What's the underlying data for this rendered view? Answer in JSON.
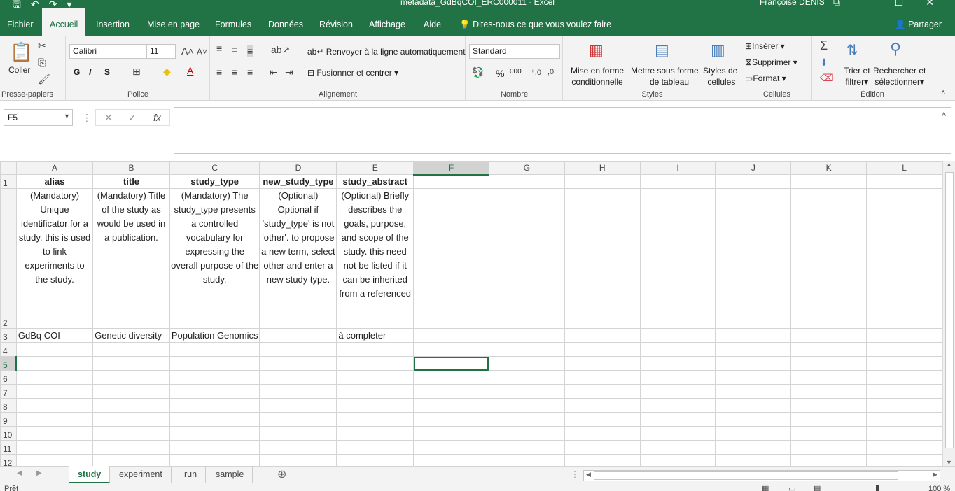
{
  "window": {
    "title": "metadata_GdBqCOI_ERC000011 - Excel",
    "user": "Françoise DENIS"
  },
  "menu": {
    "tabs": [
      "Fichier",
      "Accueil",
      "Insertion",
      "Mise en page",
      "Formules",
      "Données",
      "Révision",
      "Affichage",
      "Aide"
    ],
    "active": "Accueil",
    "tellme": "Dites-nous ce que vous voulez faire",
    "share": "Partager"
  },
  "ribbon": {
    "clipboard": {
      "paste": "Coller",
      "label": "Presse-papiers"
    },
    "font": {
      "name": "Calibri",
      "size": "11",
      "label": "Police",
      "bold": "G",
      "italic": "I",
      "underline": "S"
    },
    "alignment": {
      "wrap": "Renvoyer à la ligne automatiquement",
      "merge": "Fusionner et centrer",
      "label": "Alignement"
    },
    "number": {
      "format": "Standard",
      "label": "Nombre",
      "percent": "%",
      "thousands": "000"
    },
    "styles": {
      "conditional1": "Mise en forme",
      "conditional2": "conditionnelle",
      "table1": "Mettre sous forme",
      "table2": "de tableau",
      "cell1": "Styles de",
      "cell2": "cellules",
      "label": "Styles"
    },
    "cells": {
      "insert": "Insérer",
      "delete": "Supprimer",
      "format": "Format",
      "label": "Cellules"
    },
    "editing": {
      "sort1": "Trier et",
      "sort2": "filtrer",
      "find1": "Rechercher et",
      "find2": "sélectionner",
      "label": "Édition"
    }
  },
  "formula": {
    "namebox": "F5",
    "fx": "fx",
    "content": ""
  },
  "grid": {
    "columns": [
      "A",
      "B",
      "C",
      "D",
      "E",
      "F",
      "G",
      "H",
      "I",
      "J",
      "K",
      "L"
    ],
    "selected_column": "F",
    "selected_row": "5",
    "rows": [
      "1",
      "2",
      "3",
      "4",
      "5",
      "6",
      "7",
      "8",
      "9",
      "10",
      "11",
      "12"
    ],
    "headers": [
      "alias",
      "title",
      "study_type",
      "new_study_type",
      "study_abstract"
    ],
    "descriptions": [
      "(Mandatory) Unique identificator for a study. this is used to link experiments to the study.",
      "(Mandatory) Title of the study as would be used in a publication.",
      "(Mandatory) The study_type presents a controlled vocabulary for expressing the overall purpose of the study.",
      "(Optional) Optional if 'study_type' is not 'other'. to propose a new term, select other and enter a new study type.",
      "(Optional) Briefly describes the goals, purpose, and scope of the study.  this need not be listed if it can be inherited from a referenced"
    ],
    "row3": [
      "GdBq COI",
      "Genetic diversity",
      "Population Genomics",
      "",
      "à completer"
    ]
  },
  "sheets": {
    "tabs": [
      "study",
      "experiment",
      "run",
      "sample"
    ],
    "active": "study"
  },
  "status": {
    "text": "Prêt",
    "zoom": "100 %"
  }
}
